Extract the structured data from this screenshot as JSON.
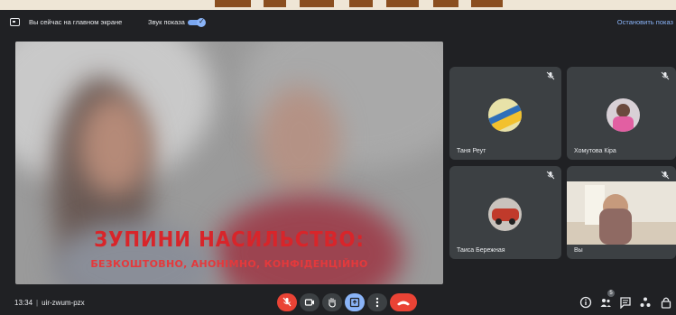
{
  "banner": {
    "presenting_text": "Вы сейчас на главном экране",
    "sound_label": "Звук показа",
    "stop_button": "Остановить показ"
  },
  "main_video": {
    "caption_line1": "ЗУПИНИ НАСИЛЬСТВО:",
    "caption_line2": "БЕЗКОШТОВНО, АНОНІМНО, КОНФІДЕНЦІЙНО"
  },
  "participants": [
    {
      "name": "Таня Реут",
      "muted": true
    },
    {
      "name": "Хомутова Кіра",
      "muted": true
    },
    {
      "name": "Таиса Бережная",
      "muted": true
    },
    {
      "name": "Вы",
      "muted": true
    }
  ],
  "bottom": {
    "time": "13:34",
    "meeting_code": "uir-zwum-pzx",
    "participant_count": "5"
  },
  "colors": {
    "background": "#202124",
    "tile": "#3c4043",
    "accent": "#8ab4f8",
    "danger": "#ea4335"
  },
  "icons": {
    "mic_off": "mic-off-icon",
    "camera": "camera-icon",
    "hand": "raise-hand-icon",
    "present": "present-icon",
    "more": "more-icon",
    "end_call": "end-call-icon"
  }
}
